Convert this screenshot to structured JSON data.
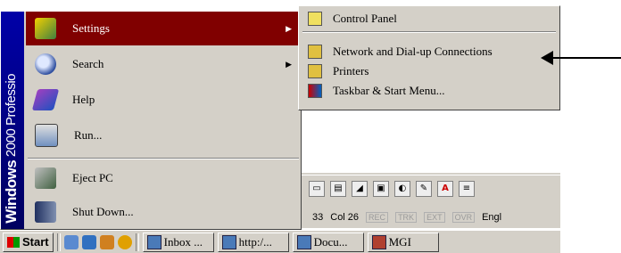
{
  "start_menu": {
    "band_text_bold": "Windows",
    "band_text_light": " 2000 Professio",
    "items": [
      {
        "label": "Settings",
        "icon": "settings-icon",
        "has_submenu": true
      },
      {
        "label": "Search",
        "icon": "search-icon",
        "has_submenu": true
      },
      {
        "label": "Help",
        "icon": "help-icon",
        "has_submenu": false
      },
      {
        "label": "Run...",
        "icon": "run-icon",
        "has_submenu": false
      },
      {
        "label": "Eject PC",
        "icon": "eject-icon",
        "has_submenu": false
      },
      {
        "label": "Shut Down...",
        "icon": "shutdown-icon",
        "has_submenu": false
      }
    ]
  },
  "settings_submenu": {
    "items": [
      {
        "label": "Control Panel",
        "icon": "control-panel-icon"
      },
      {
        "label": "Network and Dial-up Connections",
        "icon": "network-icon"
      },
      {
        "label": "Printers",
        "icon": "printers-icon"
      },
      {
        "label": "Taskbar & Start Menu...",
        "icon": "taskbar-icon"
      }
    ]
  },
  "statusbar": {
    "line": "33",
    "col": "Col 26",
    "rec": "REC",
    "trk": "TRK",
    "ext": "EXT",
    "ovr": "OVR",
    "lang": "Engl"
  },
  "taskbar": {
    "start_label": "Start",
    "tasks": [
      {
        "label": "Inbox ..."
      },
      {
        "label": "http:/..."
      },
      {
        "label": "Docu..."
      },
      {
        "label": "MGI"
      }
    ]
  },
  "colors": {
    "highlight": "#800000",
    "band": "#0000a8",
    "face": "#d4d0c8"
  }
}
